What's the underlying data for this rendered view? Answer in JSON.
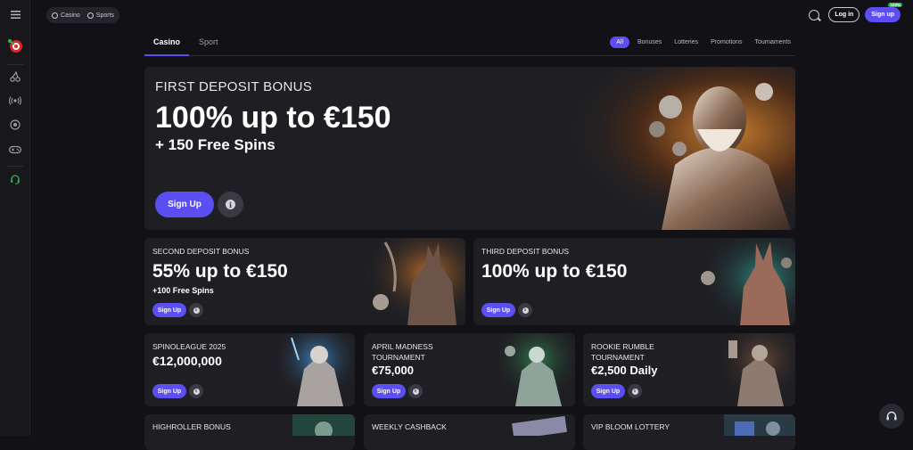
{
  "topbar": {
    "casino_label": "Casino",
    "sports_label": "Sports",
    "login_label": "Log in",
    "signup_label": "Sign up",
    "signup_badge": "100%"
  },
  "tabs": {
    "casino": "Casino",
    "sport": "Sport"
  },
  "filters": [
    "All",
    "Bonuses",
    "Lotteries",
    "Promotions",
    "Tournaments"
  ],
  "hero": {
    "kicker": "FIRST DEPOSIT BONUS",
    "title": "100% up to €150",
    "subtitle": "+ 150 Free Spins",
    "button": "Sign Up"
  },
  "second": {
    "kicker": "SECOND DEPOSIT BONUS",
    "title": "55% up to €150",
    "subtitle": "+100 Free Spins",
    "button": "Sign Up"
  },
  "third": {
    "kicker": "THIRD DEPOSIT BONUS",
    "title": "100% up to €150",
    "button": "Sign Up"
  },
  "cards_row3": [
    {
      "kicker": "SPINOLEAGUE 2025",
      "title": "€12,000,000",
      "button": "Sign Up"
    },
    {
      "kicker": "APRIL MADNESS",
      "kicker2": "TOURNAMENT",
      "title": "€75,000",
      "button": "Sign Up"
    },
    {
      "kicker": "ROOKIE RUMBLE",
      "kicker2": "TOURNAMENT",
      "title": "€2,500 Daily",
      "button": "Sign Up"
    }
  ],
  "cards_row4": [
    {
      "kicker": "HIGHROLLER BONUS"
    },
    {
      "kicker": "WEEKLY CASHBACK"
    },
    {
      "kicker": "VIP BLOOM LOTTERY"
    }
  ],
  "colors": {
    "accent": "#5b4ef2",
    "background": "#121216",
    "card": "#1f1f23",
    "badge": "#1fbb4a"
  }
}
